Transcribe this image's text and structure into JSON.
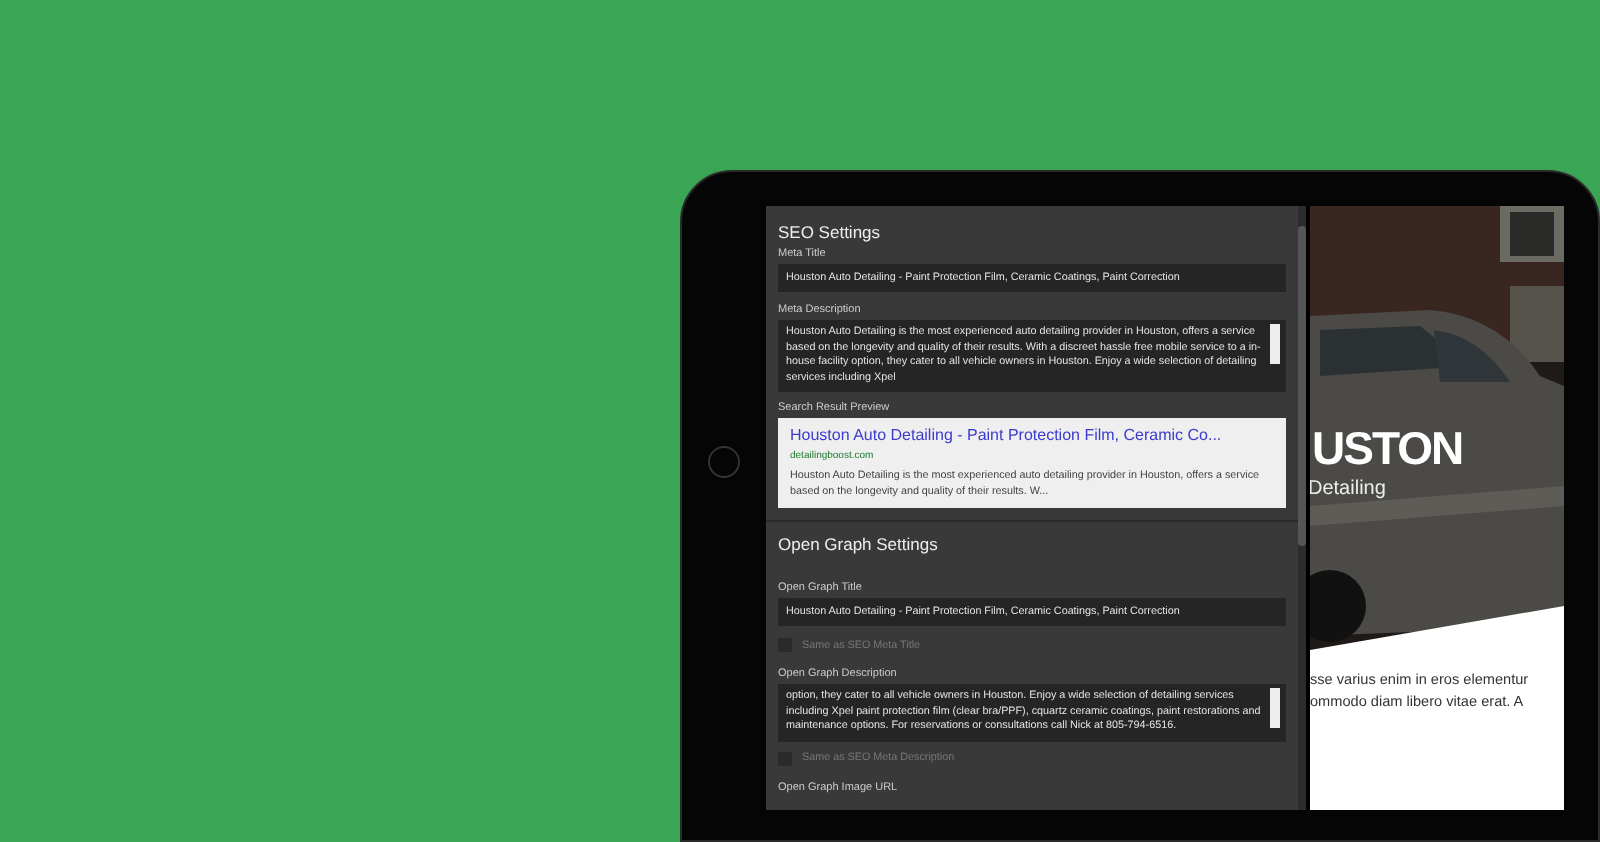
{
  "seo_settings": {
    "heading": "SEO Settings",
    "meta_title": {
      "label": "Meta Title",
      "value": "Houston Auto Detailing - Paint Protection Film, Ceramic Coatings, Paint Correction"
    },
    "meta_description": {
      "label": "Meta Description",
      "value": "Houston Auto Detailing is the most experienced auto detailing provider in Houston, offers a service based on the longevity and quality of their results. With a discreet hassle free mobile service to a in-house facility option, they cater to all vehicle owners in Houston. Enjoy a wide selection of detailing services including Xpel"
    },
    "preview_label": "Search Result Preview",
    "preview": {
      "title": "Houston Auto Detailing - Paint Protection Film, Ceramic Co...",
      "url": "detailingboost.com",
      "description": "Houston Auto Detailing is the most experienced auto detailing provider in Houston, offers a service based on the longevity and quality of their results. W..."
    }
  },
  "open_graph_settings": {
    "heading": "Open Graph Settings",
    "og_title": {
      "label": "Open Graph Title",
      "value": "Houston Auto Detailing - Paint Protection Film, Ceramic Coatings, Paint Correction"
    },
    "same_title": {
      "label": "Same as SEO Meta Title",
      "checked": false
    },
    "og_description": {
      "label": "Open Graph Description",
      "value": "option, they cater to all vehicle owners in Houston. Enjoy a wide selection of detailing services including Xpel paint protection film (clear bra/PPF), cquartz ceramic coatings, paint restorations and maintenance options. For reservations or consultations call Nick at 805-794-6516."
    },
    "same_description": {
      "label": "Same as SEO Meta Description",
      "checked": false
    },
    "image_url_label": "Open Graph Image URL"
  },
  "site_preview": {
    "hero_title": "USTON",
    "hero_subtitle": "Detailing",
    "body_lines": [
      "sse varius enim in eros elementur",
      "ommodo diam libero vitae erat. A"
    ]
  }
}
